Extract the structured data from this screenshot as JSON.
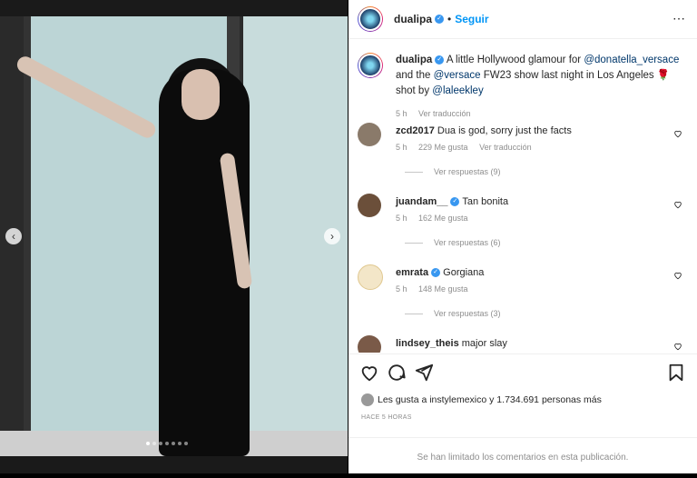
{
  "post": {
    "username": "dualipa",
    "follow_label": "Seguir",
    "more_icon": "⋯",
    "dots_count": 7,
    "active_dot": 0,
    "prev_label": "‹",
    "next_label": "›"
  },
  "caption": {
    "username": "dualipa",
    "text_1": "A little Hollywood glamour for",
    "mention_1": "@donatella_versace",
    "text_2": "and the",
    "mention_2": "@versace",
    "text_3": "FW23 show last night in Los Angeles 🌹",
    "text_4": "shot by",
    "mention_3": "@laleekley",
    "time": "5 h",
    "translate": "Ver traducción"
  },
  "comments": [
    {
      "username": "zcd2017",
      "verified": false,
      "text": "Dua is god, sorry just the facts",
      "time": "5 h",
      "likes": "229 Me gusta",
      "translate": "Ver traducción",
      "replies": "Ver respuestas (9)",
      "avatar_color": "#8a7a6a"
    },
    {
      "username": "juandam__",
      "verified": true,
      "text": "Tan bonita",
      "time": "5 h",
      "likes": "162 Me gusta",
      "translate": "",
      "replies": "Ver respuestas (6)",
      "avatar_color": "#6b4f3a"
    },
    {
      "username": "emrata",
      "verified": true,
      "text": "Gorgiana",
      "time": "5 h",
      "likes": "148 Me gusta",
      "translate": "",
      "replies": "Ver respuestas (3)",
      "avatar_color": "#f3e6c8"
    },
    {
      "username": "lindsey_theis",
      "verified": false,
      "text": "major slay",
      "time": "",
      "likes": "",
      "translate": "",
      "replies": "",
      "avatar_color": "#7a5a48"
    }
  ],
  "likes_text": "Les gusta a instylemexico y 1.734.691 personas más",
  "timestamp": "HACE 5 HORAS",
  "footer": "Se han limitado los comentarios en esta publicación."
}
